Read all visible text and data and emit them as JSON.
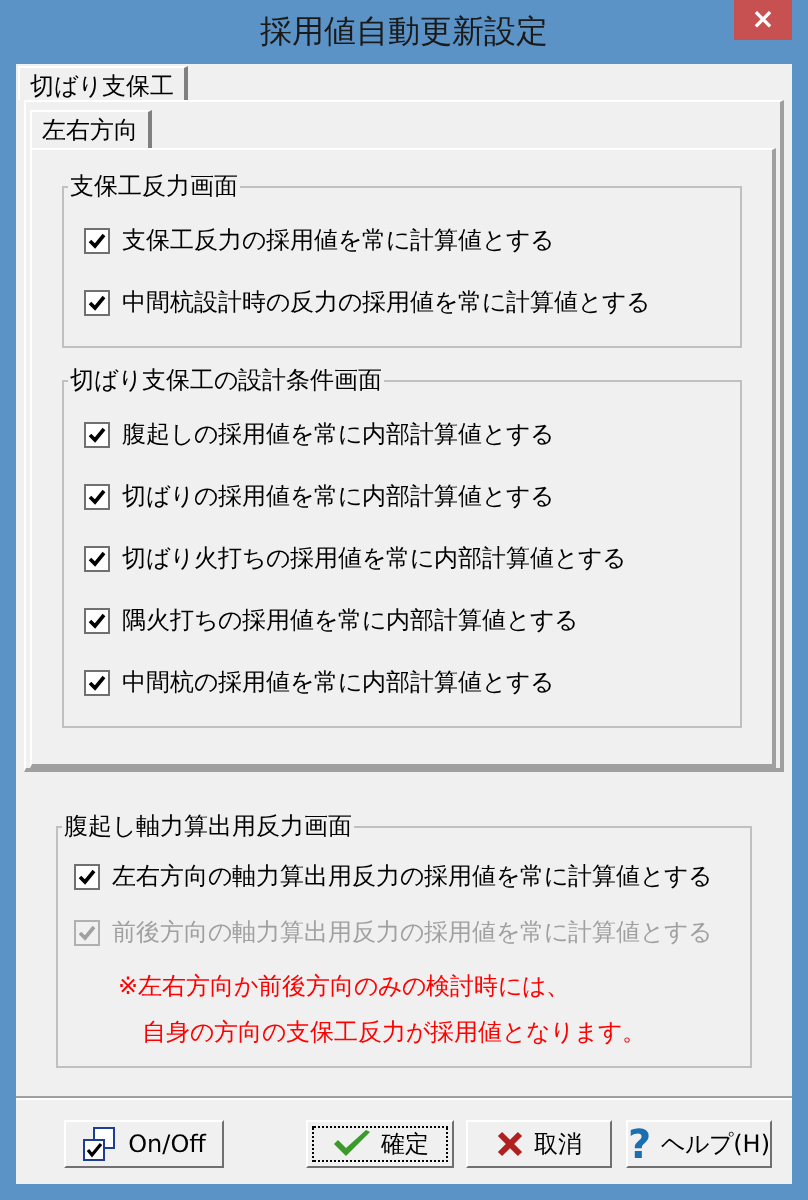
{
  "window": {
    "title": "採用値自動更新設定",
    "close": "×"
  },
  "tabs": [
    {
      "label": "切ばり支保工",
      "selected": true
    }
  ],
  "subtabs": [
    {
      "label": "左右方向",
      "selected": true
    }
  ],
  "groups": [
    {
      "title": "支保工反力画面",
      "items": [
        {
          "label": "支保工反力の採用値を常に計算値とする",
          "checked": true,
          "disabled": false
        },
        {
          "label": "中間杭設計時の反力の採用値を常に計算値とする",
          "checked": true,
          "disabled": false
        }
      ]
    },
    {
      "title": "切ばり支保工の設計条件画面",
      "items": [
        {
          "label": "腹起しの採用値を常に内部計算値とする",
          "checked": true,
          "disabled": false
        },
        {
          "label": "切ばりの採用値を常に内部計算値とする",
          "checked": true,
          "disabled": false
        },
        {
          "label": "切ばり火打ちの採用値を常に内部計算値とする",
          "checked": true,
          "disabled": false
        },
        {
          "label": "隅火打ちの採用値を常に内部計算値とする",
          "checked": true,
          "disabled": false
        },
        {
          "label": "中間杭の採用値を常に内部計算値とする",
          "checked": true,
          "disabled": false
        }
      ]
    }
  ],
  "bottom_group": {
    "title": "腹起し軸力算出用反力画面",
    "items": [
      {
        "label": "左右方向の軸力算出用反力の採用値を常に計算値とする",
        "checked": true,
        "disabled": false
      },
      {
        "label": "前後方向の軸力算出用反力の採用値を常に計算値とする",
        "checked": true,
        "disabled": true
      }
    ],
    "note": [
      "※左右方向か前後方向のみの検討時には、",
      "自身の方向の支保工反力が採用値となります。"
    ]
  },
  "buttons": [
    {
      "kind": "onoff",
      "label": "On/Off"
    },
    {
      "kind": "ok",
      "label": "確定"
    },
    {
      "kind": "cancel",
      "label": "取消"
    },
    {
      "kind": "help",
      "icon": "?",
      "label": "ヘルプ(H)"
    }
  ]
}
